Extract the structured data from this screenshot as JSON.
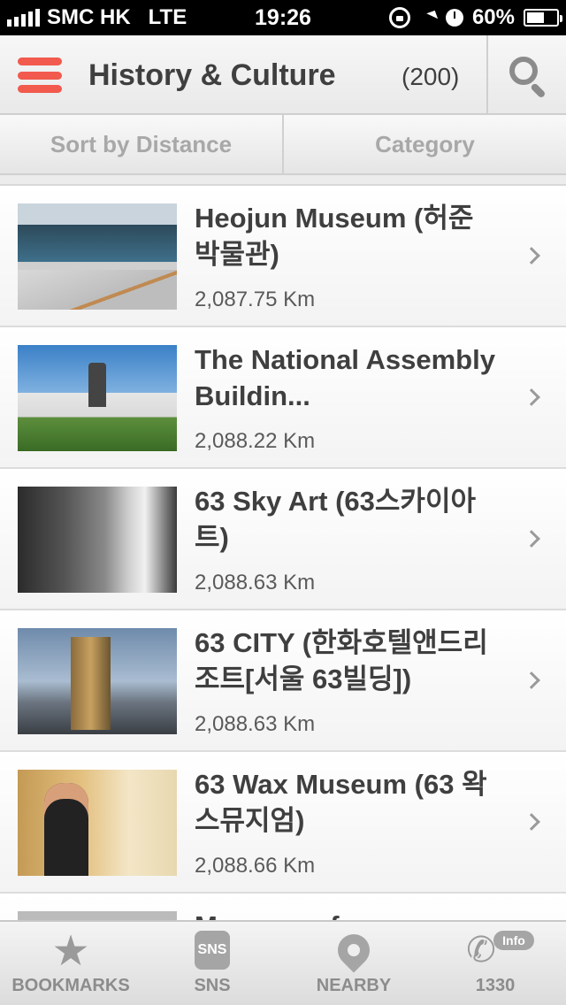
{
  "status_bar": {
    "carrier": "SMC HK",
    "network": "LTE",
    "time": "19:26",
    "battery_text": "60%",
    "battery_level": 0.6
  },
  "header": {
    "title": "History & Culture",
    "count": "(200)",
    "menu_icon": "hamburger-menu-icon",
    "search_icon": "search-icon",
    "accent_color": "#f15a4d"
  },
  "sort_bar": {
    "sort_label": "Sort by Distance",
    "category_label": "Category"
  },
  "list": {
    "items": [
      {
        "title": "Heojun Museum (허준박물관)",
        "distance": "2,087.75 Km"
      },
      {
        "title": "The National Assembly Buildin...",
        "distance": "2,088.22 Km"
      },
      {
        "title": "63 Sky Art (63스카이아트)",
        "distance": "2,088.63 Km"
      },
      {
        "title": "63 CITY (한화호텔앤드리조트[서울 63빌딩])",
        "distance": "2,088.63 Km"
      },
      {
        "title": "63 Wax Museum (63 왁스뮤지엄)",
        "distance": "2,088.66 Km"
      },
      {
        "title": "Museum of",
        "distance": ""
      }
    ]
  },
  "tab_bar": {
    "tabs": [
      {
        "label": "BOOKMARKS",
        "icon": "star-icon"
      },
      {
        "label": "SNS",
        "icon": "sns-icon"
      },
      {
        "label": "NEARBY",
        "icon": "location-pin-icon"
      },
      {
        "label": "1330",
        "icon": "phone-icon"
      }
    ],
    "info_badge": "Info",
    "sns_icon_text": "SNS"
  }
}
